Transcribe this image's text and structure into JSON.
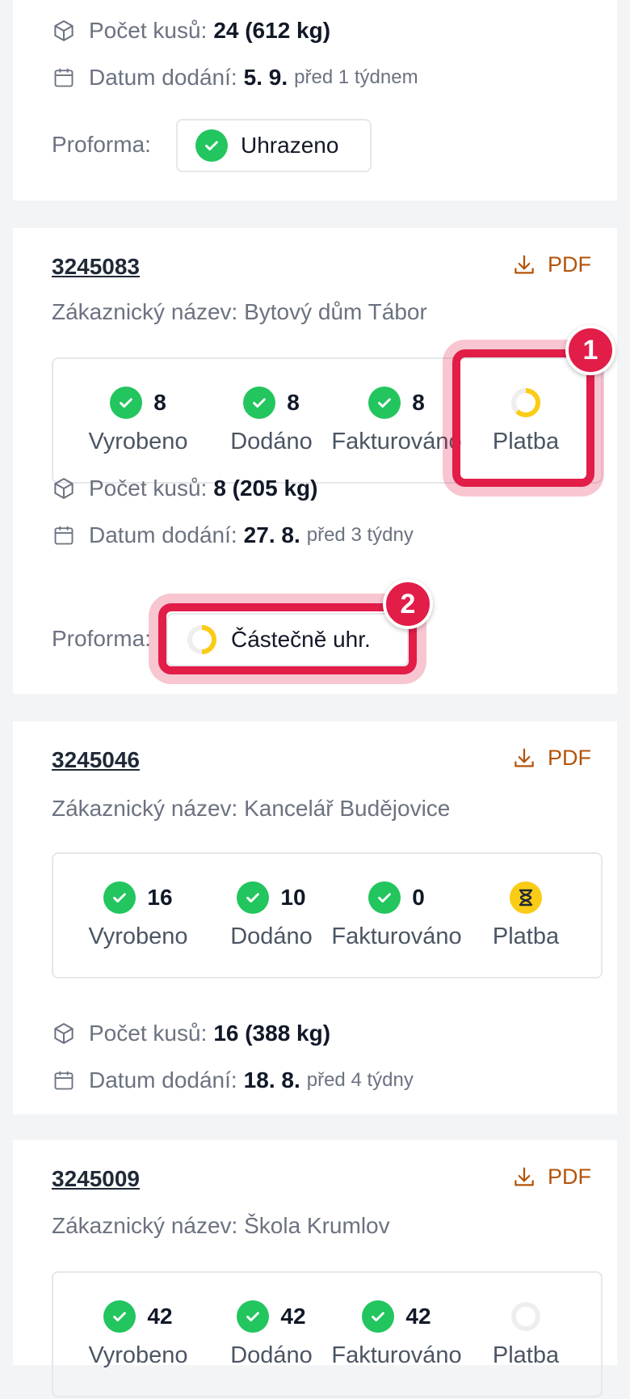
{
  "labels": {
    "pieces": "Počet kusů:",
    "delivery": "Datum dodání:",
    "proforma": "Proforma:",
    "customer_prefix": "Zákaznický název:",
    "pdf": "PDF",
    "produced": "Vyrobeno",
    "delivered": "Dodáno",
    "invoiced": "Fakturováno",
    "payment": "Platba"
  },
  "colors": {
    "accent": "#e11d48",
    "success": "#22c55e",
    "pending": "#facc15",
    "pdf": "#b45309"
  },
  "card0": {
    "pieces_value": "24 (612 kg)",
    "delivery_date": "5. 9.",
    "delivery_relative": "před 1 týdnem",
    "proforma_status": "Uhrazeno"
  },
  "card1": {
    "order_id": "3245083",
    "customer": "Zákaznický název: Bytový dům Tábor",
    "produced": "8",
    "delivered": "8",
    "invoiced": "8",
    "payment_state": "partial",
    "pieces_value": "8 (205 kg)",
    "delivery_date": "27. 8.",
    "delivery_relative": "před 3 týdny",
    "proforma_status": "Částečně uhr.",
    "badge_payment": "1",
    "badge_proforma": "2"
  },
  "card2": {
    "order_id": "3245046",
    "customer": "Zákaznický název: Kancelář Budějovice",
    "produced": "16",
    "delivered": "10",
    "invoiced": "0",
    "payment_state": "pending",
    "pieces_value": "16 (388 kg)",
    "delivery_date": "18. 8.",
    "delivery_relative": "před 4 týdny"
  },
  "card3": {
    "order_id": "3245009",
    "customer": "Zákaznický název: Škola Krumlov",
    "produced": "42",
    "delivered": "42",
    "invoiced": "42",
    "payment_state": "none"
  }
}
